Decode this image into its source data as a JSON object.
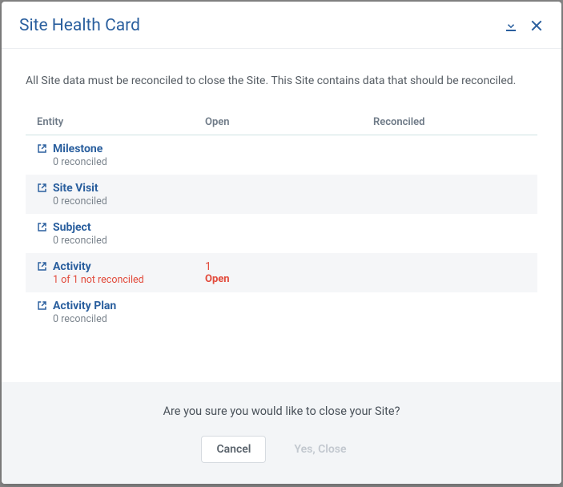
{
  "header": {
    "title": "Site Health Card"
  },
  "intro": "All Site data must be reconciled to close the Site. This Site contains data that should be reconciled.",
  "columns": {
    "entity": "Entity",
    "open": "Open",
    "reconciled": "Reconciled"
  },
  "rows": [
    {
      "entity": "Milestone",
      "sub": "0 reconciled",
      "open_num": "",
      "open_label": "",
      "error": false,
      "striped": false
    },
    {
      "entity": "Site Visit",
      "sub": "0 reconciled",
      "open_num": "",
      "open_label": "",
      "error": false,
      "striped": true
    },
    {
      "entity": "Subject",
      "sub": "0 reconciled",
      "open_num": "",
      "open_label": "",
      "error": false,
      "striped": false
    },
    {
      "entity": "Activity",
      "sub": "1 of 1 not reconciled",
      "open_num": "1",
      "open_label": "Open",
      "error": true,
      "striped": true
    },
    {
      "entity": "Activity Plan",
      "sub": "0 reconciled",
      "open_num": "",
      "open_label": "",
      "error": false,
      "striped": false
    }
  ],
  "footer": {
    "confirm": "Are you sure you would like to close your Site?",
    "cancel": "Cancel",
    "yes": "Yes, Close"
  }
}
